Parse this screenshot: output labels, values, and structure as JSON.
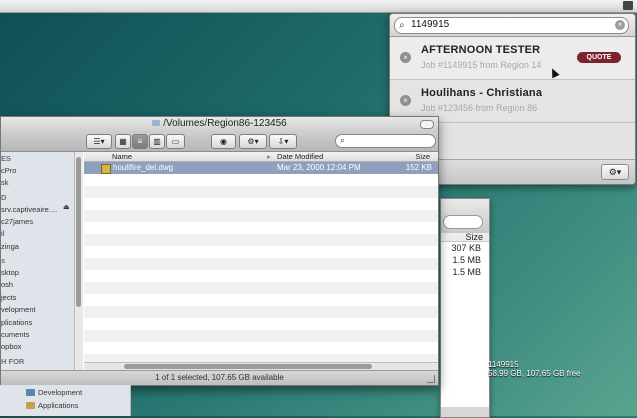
{
  "menubar": {
    "icon": "dropbox-icon"
  },
  "spotlight": {
    "query": "1149915",
    "results": [
      {
        "title": "AFTERNOON TESTER",
        "subtitle": "Job #1149915 from Region 14",
        "badge": "QUOTE"
      },
      {
        "title": "Houlihans - Christiana",
        "subtitle": "Job #123456 from Region 86",
        "badge": ""
      }
    ],
    "footer_gear": "⚙▾"
  },
  "finder": {
    "title": "/Volumes/Region86-123456",
    "sidebar": [
      {
        "label": "ES",
        "type": "header"
      },
      {
        "label": "cPro",
        "type": "item"
      },
      {
        "label": "sk",
        "type": "item"
      },
      {
        "label": "D",
        "type": "header"
      },
      {
        "label": "srv.captiveaire....",
        "type": "item"
      },
      {
        "label": "c27james",
        "type": "item"
      },
      {
        "label": "il",
        "type": "item"
      },
      {
        "label": "zinga",
        "type": "item"
      },
      {
        "label": "s",
        "type": "header"
      },
      {
        "label": "sktop",
        "type": "item"
      },
      {
        "label": "osh",
        "type": "item"
      },
      {
        "label": "jects",
        "type": "item"
      },
      {
        "label": "velopment",
        "type": "item"
      },
      {
        "label": "plications",
        "type": "item"
      },
      {
        "label": "cuments",
        "type": "item"
      },
      {
        "label": "opbox",
        "type": "item"
      },
      {
        "label": "H FOR",
        "type": "header"
      }
    ],
    "columns": {
      "name": "Name",
      "date": "Date Modified",
      "size": "Size"
    },
    "files": [
      {
        "name": "houlifire_del.dwg",
        "date": "Mar 23, 2000 12:04 PM",
        "size": "152 KB"
      }
    ],
    "status": "1 of 1 selected, 107.65 GB available"
  },
  "back_window": {
    "size_header": "Size",
    "sizes": [
      "307 KB",
      "1.5 MB",
      "1.5 MB"
    ]
  },
  "desktop": {
    "label1": "1149915",
    "label2": "58.99 GB, 107.65 GB free"
  },
  "lower_sidebar": [
    "Development",
    "Applications"
  ]
}
